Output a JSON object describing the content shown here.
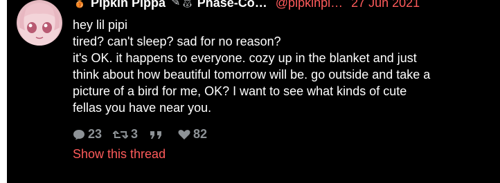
{
  "tweet": {
    "display_name": "Pipkin Pippa",
    "display_name_suffix": "Phase-Co…",
    "handle": "@pipkinpi…",
    "date": "27 Jun 2021",
    "lines": [
      "hey lil pipi",
      "tired? can't sleep? sad for no reason?",
      "it's OK. it happens to everyone. cozy up in the blanket and just",
      "think about how beautiful tomorrow will be. go outside and take a",
      "picture of a bird for me, OK? I want to see what kinds of cute",
      "fellas you have near you."
    ],
    "stats": {
      "replies": "23",
      "retweets": "3",
      "likes": "82"
    },
    "show_thread": "Show this thread",
    "icons": {
      "medal": "medal-icon",
      "emoji": "bunny-emoji-icon",
      "reply": "reply-icon",
      "retweet": "retweet-icon",
      "quote": "quote-icon",
      "like": "heart-icon"
    },
    "colors": {
      "accent": "#ff5b5b",
      "text": "#ffffff",
      "muted": "#8d9296",
      "background": "#000000"
    }
  }
}
